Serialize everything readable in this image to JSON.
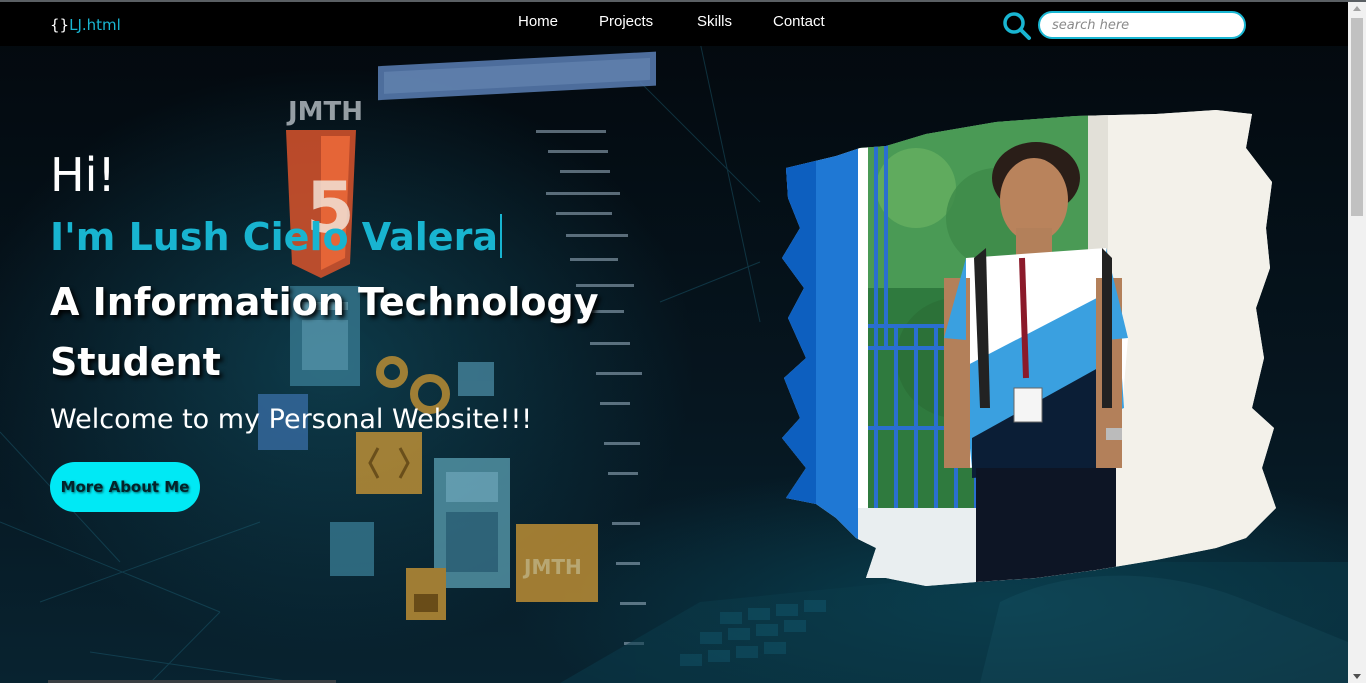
{
  "nav": {
    "logo_braces": "{}",
    "logo_name": "LJ.html",
    "items": [
      {
        "label": "Home"
      },
      {
        "label": "Projects"
      },
      {
        "label": "Skills"
      },
      {
        "label": "Contact"
      }
    ],
    "search_placeholder": "search here",
    "search_icon": "search-icon"
  },
  "hero": {
    "greeting": "Hi!",
    "name_line": "I'm Lush Cielo Valera",
    "role": "A Information Technology Student",
    "welcome": "Welcome to my Personal Website!!!",
    "cta_label": "More About Me",
    "background_art": {
      "html_badge_label": "JMTH",
      "html_badge_number": "5",
      "panel_badge_label": "JMTH"
    }
  },
  "colors": {
    "accent": "#18b4d0",
    "cta": "#00e9f5",
    "nav_bg": "#000000"
  }
}
